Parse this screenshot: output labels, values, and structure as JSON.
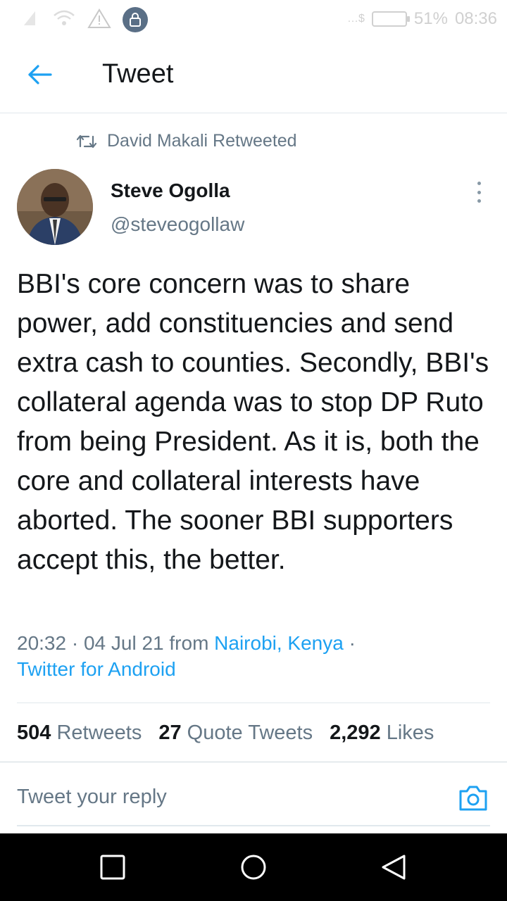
{
  "status_bar": {
    "battery": "51%",
    "time": "08:36"
  },
  "header": {
    "title": "Tweet"
  },
  "retweet": {
    "label": "David Makali Retweeted"
  },
  "author": {
    "name": "Steve Ogolla",
    "handle": "@steveogollaw"
  },
  "tweet": {
    "text": "BBI's core concern was to share power, add constituencies and send extra cash to counties. Secondly, BBI's collateral agenda was to stop DP Ruto from being President. As it is, both the core and collateral interests have aborted. The sooner BBI supporters accept this, the better.",
    "time": "20:32",
    "date": "04 Jul 21",
    "from_label": "from",
    "location": "Nairobi, Kenya",
    "source": "Twitter for Android"
  },
  "stats": {
    "retweets_count": "504",
    "retweets_label": "Retweets",
    "quotes_count": "27",
    "quotes_label": "Quote Tweets",
    "likes_count": "2,292",
    "likes_label": "Likes"
  },
  "reply": {
    "placeholder": "Tweet your reply"
  },
  "colors": {
    "accent": "#1da1f2",
    "secondary_text": "#657786",
    "primary_text": "#14171a"
  },
  "icons": [
    "back-arrow-icon",
    "retweet-icon",
    "more-vertical-icon",
    "camera-icon",
    "recent-apps-icon",
    "home-icon",
    "back-icon"
  ]
}
